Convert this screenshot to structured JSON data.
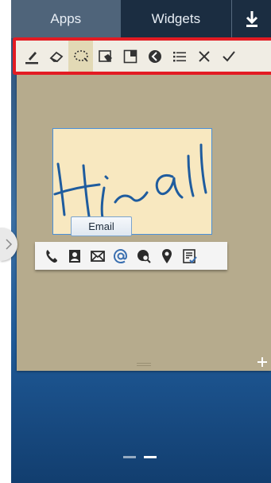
{
  "tabs": {
    "apps_label": "Apps",
    "widgets_label": "Widgets",
    "download_icon": "download-icon"
  },
  "toolbar": {
    "tools": [
      {
        "name": "pen-icon",
        "active": false
      },
      {
        "name": "eraser-icon",
        "active": false
      },
      {
        "name": "lasso-select-icon",
        "active": true
      },
      {
        "name": "background-color-icon",
        "active": false
      },
      {
        "name": "resize-window-icon",
        "active": false
      },
      {
        "name": "collapse-icon",
        "active": false
      },
      {
        "name": "menu-icon",
        "active": false
      },
      {
        "name": "close-icon",
        "active": false
      },
      {
        "name": "done-check-icon",
        "active": false
      }
    ],
    "highlight_color": "#e31b23"
  },
  "note": {
    "handwriting": "Hi~all"
  },
  "tooltip": {
    "label": "Email"
  },
  "action_bar": {
    "actions": [
      "phone-icon",
      "contact-icon",
      "message-icon",
      "email-icon",
      "browser-search-icon",
      "map-pin-icon",
      "task-icon"
    ]
  },
  "page_indicator": {
    "pages": 2,
    "current": 2
  },
  "colors": {
    "memo_background": "#b6ab8d",
    "note_background": "#f8e8c0",
    "selection_border": "#4a90d9",
    "ink": "#1f5c9e"
  }
}
